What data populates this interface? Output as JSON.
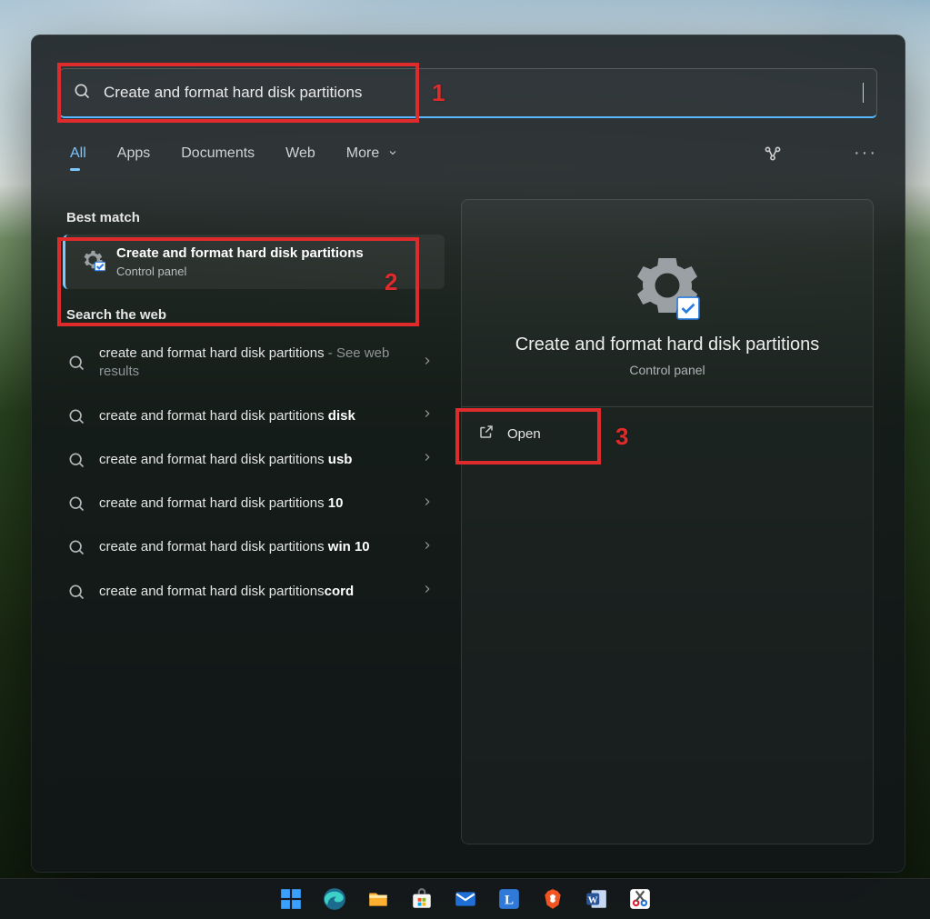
{
  "searchbox": {
    "value": "Create and format hard disk partitions"
  },
  "tabs": {
    "all": "All",
    "apps": "Apps",
    "documents": "Documents",
    "web": "Web",
    "more": "More"
  },
  "sections": {
    "best_match": "Best match",
    "search_web": "Search the web"
  },
  "best_match": {
    "title": "Create and format hard disk partitions",
    "subtitle": "Control panel"
  },
  "web_results": [
    {
      "prefix": "create and format hard disk partitions",
      "bold": "",
      "suffix": " - See web results"
    },
    {
      "prefix": "create and format hard disk partitions ",
      "bold": "disk",
      "suffix": ""
    },
    {
      "prefix": "create and format hard disk partitions ",
      "bold": "usb",
      "suffix": ""
    },
    {
      "prefix": "create and format hard disk partitions ",
      "bold": "10",
      "suffix": ""
    },
    {
      "prefix": "create and format hard disk partitions ",
      "bold": "win 10",
      "suffix": ""
    },
    {
      "prefix": "create and format hard disk partitions",
      "bold": "cord",
      "suffix": ""
    }
  ],
  "preview": {
    "title": "Create and format hard disk partitions",
    "subtitle": "Control panel",
    "open_label": "Open"
  },
  "annotations": {
    "n1": "1",
    "n2": "2",
    "n3": "3"
  },
  "taskbar": {
    "items": [
      "start",
      "edge",
      "file-explorer",
      "microsoft-store",
      "mail",
      "letter-l",
      "brave",
      "word",
      "snipping-tool"
    ]
  }
}
